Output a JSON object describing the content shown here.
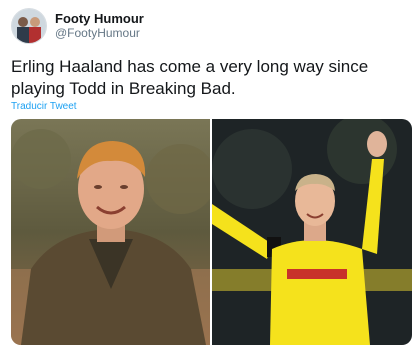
{
  "tweet": {
    "author": {
      "display_name": "Footy Humour",
      "handle": "@FootyHumour"
    },
    "text": "Erling Haaland has come a very long way since playing Todd in Breaking Bad.",
    "translate_label": "Traducir Tweet",
    "colors": {
      "link": "#1da1f2",
      "text": "#14171a",
      "secondary": "#657786",
      "jersey": "#f5e21c"
    }
  }
}
